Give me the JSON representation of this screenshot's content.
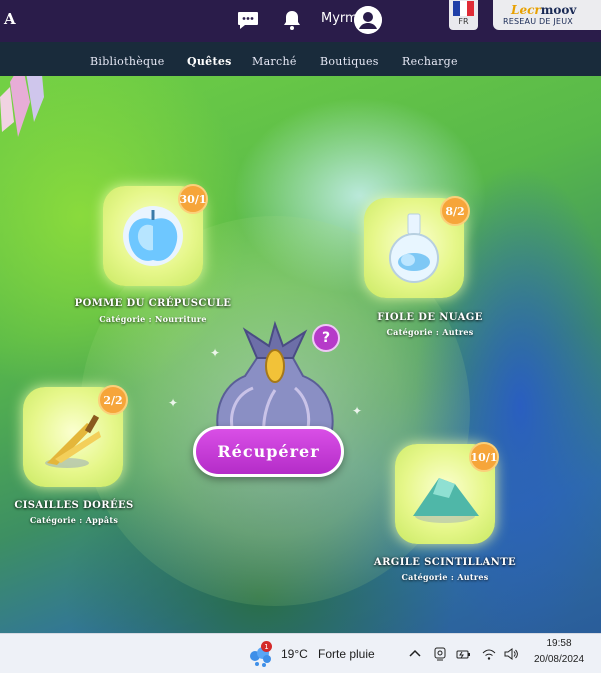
{
  "header": {
    "logo_letter": "A",
    "username": "Myrmica",
    "language": "FR",
    "partner_brand_a": "Lecr",
    "partner_brand_b": "moov",
    "partner_tagline": "RESEAU DE JEUX",
    "icons": [
      "chat-icon",
      "bell-icon",
      "avatar-icon",
      "france-flag-icon"
    ]
  },
  "nav": {
    "items": [
      {
        "label": "Bibliothèque",
        "active": false
      },
      {
        "label": "Quêtes",
        "active": true
      },
      {
        "label": "Marché",
        "active": false
      },
      {
        "label": "Boutiques",
        "active": false
      },
      {
        "label": "Recharge",
        "active": false
      }
    ]
  },
  "reward": {
    "help_label": "?",
    "collect_label": "Récupérer",
    "items": [
      {
        "name": "Pomme du crépuscule",
        "category": "Catégorie : Nourriture",
        "count": "30/1",
        "icon": "apple-icon"
      },
      {
        "name": "Fiole de nuage",
        "category": "Catégorie : Autres",
        "count": "8/2",
        "icon": "cloud-flask-icon"
      },
      {
        "name": "Cisailles dorées",
        "category": "Catégorie : Appâts",
        "count": "2/2",
        "icon": "golden-shears-icon"
      },
      {
        "name": "Argile scintillante",
        "category": "Catégorie : Autres",
        "count": "10/1",
        "icon": "sparkling-clay-icon"
      }
    ]
  },
  "taskbar": {
    "weather_badge": "1",
    "temperature": "19°C",
    "condition": "Forte pluie",
    "time": "19:58",
    "date": "20/08/2024"
  },
  "colors": {
    "header_bg": "#2a1c4a",
    "nav_bg": "#14183c",
    "card_glow": "#e6f78a",
    "badge": "#f6a53a",
    "collect_button": "#c53ad8",
    "help_button": "#b63ac9"
  }
}
